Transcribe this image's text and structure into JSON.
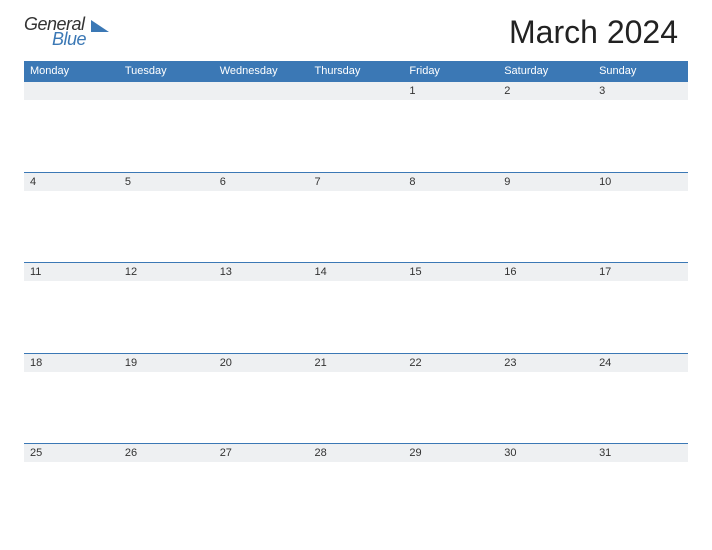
{
  "logo": {
    "text_general": "General",
    "text_blue": "Blue"
  },
  "title": "March 2024",
  "day_headers": [
    "Monday",
    "Tuesday",
    "Wednesday",
    "Thursday",
    "Friday",
    "Saturday",
    "Sunday"
  ],
  "weeks": [
    [
      "",
      "",
      "",
      "",
      "1",
      "2",
      "3"
    ],
    [
      "4",
      "5",
      "6",
      "7",
      "8",
      "9",
      "10"
    ],
    [
      "11",
      "12",
      "13",
      "14",
      "15",
      "16",
      "17"
    ],
    [
      "18",
      "19",
      "20",
      "21",
      "22",
      "23",
      "24"
    ],
    [
      "25",
      "26",
      "27",
      "28",
      "29",
      "30",
      "31"
    ]
  ]
}
